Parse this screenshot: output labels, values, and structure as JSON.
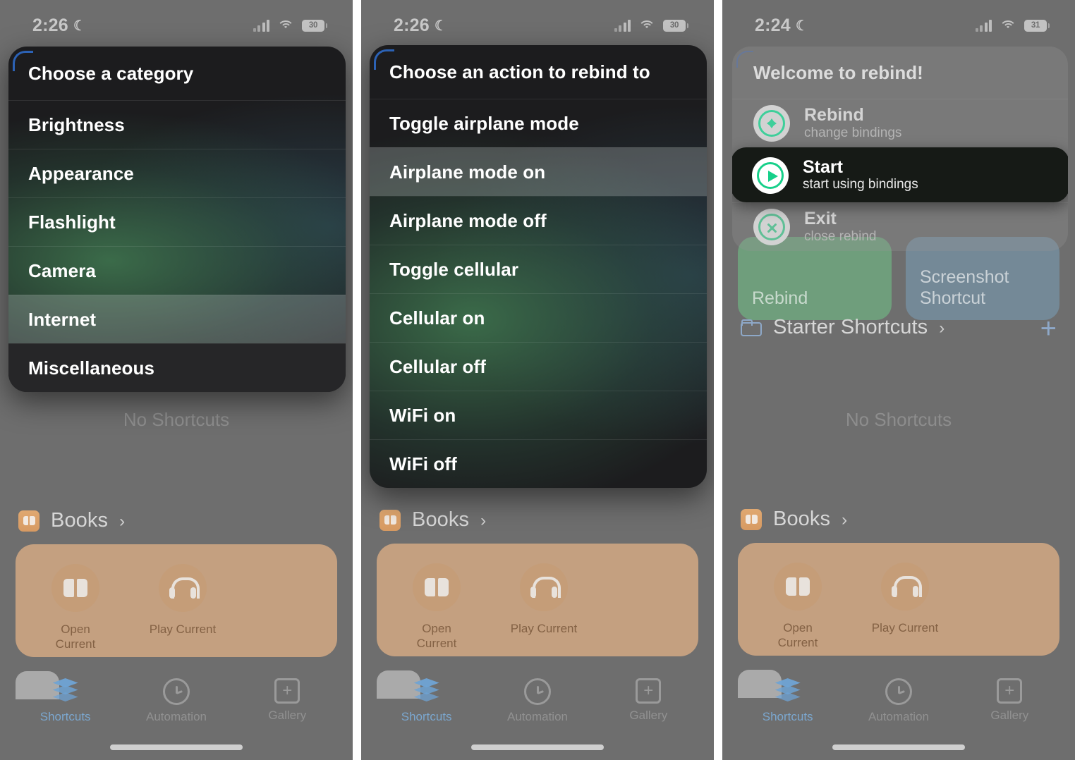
{
  "panels": [
    {
      "status": {
        "time": "2:26",
        "moon": "☾",
        "battery": "30",
        "signal_icon": "cellular-bars-icon",
        "wifi_icon": "wifi-icon"
      },
      "menu": {
        "kind": "context-menu",
        "header": "Choose a category",
        "items": [
          {
            "label": "Brightness",
            "state": "normal"
          },
          {
            "label": "Appearance",
            "state": "normal"
          },
          {
            "label": "Flashlight",
            "state": "normal"
          },
          {
            "label": "Camera",
            "state": "normal"
          },
          {
            "label": "Internet",
            "state": "highlighted"
          },
          {
            "label": "Miscellaneous",
            "state": "last"
          }
        ]
      },
      "background": {
        "empty_state": "No Shortcuts",
        "section": {
          "title": "Books",
          "icon": "books-app-icon",
          "chevron": "›"
        },
        "widget_items": [
          {
            "label": "Open\nCurrent",
            "icon": "book-icon"
          },
          {
            "label": "Play Current",
            "icon": "headphones-icon"
          }
        ]
      },
      "tabbar": [
        {
          "label": "Shortcuts",
          "icon": "layers-icon",
          "active": true
        },
        {
          "label": "Automation",
          "icon": "clock-icon",
          "active": false
        },
        {
          "label": "Gallery",
          "icon": "gallery-plus-icon",
          "active": false
        }
      ]
    },
    {
      "status": {
        "time": "2:26",
        "moon": "☾",
        "battery": "30",
        "signal_icon": "cellular-bars-icon",
        "wifi_icon": "wifi-icon"
      },
      "menu": {
        "kind": "context-menu",
        "header": "Choose an action to rebind to",
        "items": [
          {
            "label": "Toggle airplane mode",
            "state": "normal"
          },
          {
            "label": "Airplane mode on",
            "state": "highlighted"
          },
          {
            "label": "Airplane mode off",
            "state": "normal"
          },
          {
            "label": "Toggle cellular",
            "state": "normal"
          },
          {
            "label": "Cellular on",
            "state": "normal"
          },
          {
            "label": "Cellular off",
            "state": "normal"
          },
          {
            "label": "WiFi on",
            "state": "normal"
          },
          {
            "label": "WiFi off",
            "state": "normal"
          }
        ]
      },
      "background": {
        "empty_state": "No Shortcuts",
        "section": {
          "title": "Books",
          "icon": "books-app-icon",
          "chevron": "›"
        },
        "widget_items": [
          {
            "label": "Open\nCurrent",
            "icon": "book-icon"
          },
          {
            "label": "Play Current",
            "icon": "headphones-icon"
          }
        ]
      },
      "tabbar": [
        {
          "label": "Shortcuts",
          "icon": "layers-icon",
          "active": true
        },
        {
          "label": "Automation",
          "icon": "clock-icon",
          "active": false
        },
        {
          "label": "Gallery",
          "icon": "gallery-plus-icon",
          "active": false
        }
      ]
    },
    {
      "status": {
        "time": "2:24",
        "moon": "☾",
        "battery": "31",
        "signal_icon": "cellular-bars-icon",
        "wifi_icon": "wifi-icon"
      },
      "menu": {
        "kind": "welcome-menu",
        "header": "Welcome to rebind!",
        "items": [
          {
            "title": "Rebind",
            "subtitle": "change bindings",
            "icon": "compass-icon",
            "state": "normal"
          },
          {
            "title": "Start",
            "subtitle": "start using bindings",
            "icon": "play-circle-icon",
            "state": "selected"
          },
          {
            "title": "Exit",
            "subtitle": "close rebind",
            "icon": "x-circle-icon",
            "state": "normal"
          }
        ]
      },
      "background": {
        "empty_state": "No Shortcuts",
        "tiles": [
          {
            "label": "Rebind",
            "color": "#70b282"
          },
          {
            "label": "Screenshot\nShortcut",
            "color": "#789bb2"
          }
        ],
        "folder_row": {
          "title": "Starter Shortcuts",
          "icon": "folder-icon",
          "chevron": "›",
          "add": "+"
        },
        "section": {
          "title": "Books",
          "icon": "books-app-icon",
          "chevron": "›"
        },
        "widget_items": [
          {
            "label": "Open\nCurrent",
            "icon": "book-icon"
          },
          {
            "label": "Play Current",
            "icon": "headphones-icon"
          }
        ]
      },
      "tabbar": [
        {
          "label": "Shortcuts",
          "icon": "layers-icon",
          "active": true
        },
        {
          "label": "Automation",
          "icon": "clock-icon",
          "active": false
        },
        {
          "label": "Gallery",
          "icon": "gallery-plus-icon",
          "active": false
        }
      ]
    }
  ],
  "colors": {
    "dim_overlay": "#6e6e6e",
    "menu_bg": "#1c1c1e",
    "highlight_row": "#b9bfbf",
    "accent_green": "#16d08a",
    "accent_blue": "#7ba7cf",
    "books_tint": "#d9ad84"
  }
}
